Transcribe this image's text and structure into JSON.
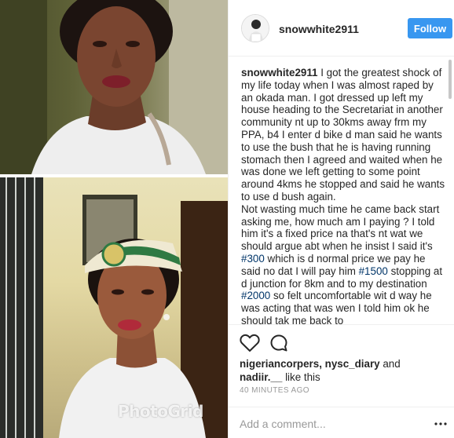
{
  "post": {
    "username": "snowwhite2911",
    "follow_label": "Follow",
    "caption_user": "snowwhite2911",
    "caption_part1": " I got the greatest shock of my life today when I was almost raped by an okada man. I got dressed up left my house heading to the Secretariat in another community nt up to 30kms away frm my PPA, b4 I enter d bike d man said he wants to use the bush that he is having running stomach then I agreed and waited when he was done we left getting to some point around 4kms he stopped and said he wants to use d bush again.",
    "caption_part2": "Not wasting much time he came back start asking me, how much am I paying ? I told him it's a fixed price na that's nt wat we should argue abt when he insist I said it's ",
    "tag_300": "#300",
    "caption_part3": " which is d normal price we pay he said no dat I will pay him ",
    "tag_1500": "#1500",
    "caption_part4": " stopping at d junction for 8km and to my destination ",
    "tag_2000": "#2000",
    "caption_part5": " so felt uncomfortable wit d way he was acting that was wen I told him ok he should tak me back to",
    "liked_by": "nigeriancorpers, nysc_diary",
    "likes_suffix_and": " and ",
    "liked_others": "nadiir.__",
    "likes_suffix_like": " like this",
    "timestamp": "40 MINUTES AGO",
    "comment_placeholder": "Add a comment..."
  },
  "photo": {
    "watermark": "PhotoGrid"
  },
  "icons": {
    "like": "heart-outline-icon",
    "comment": "speech-bubble-icon",
    "more": "ellipsis-icon"
  },
  "colors": {
    "follow_button": "#3897f0",
    "hashtag": "#003569",
    "timestamp": "#999999"
  }
}
